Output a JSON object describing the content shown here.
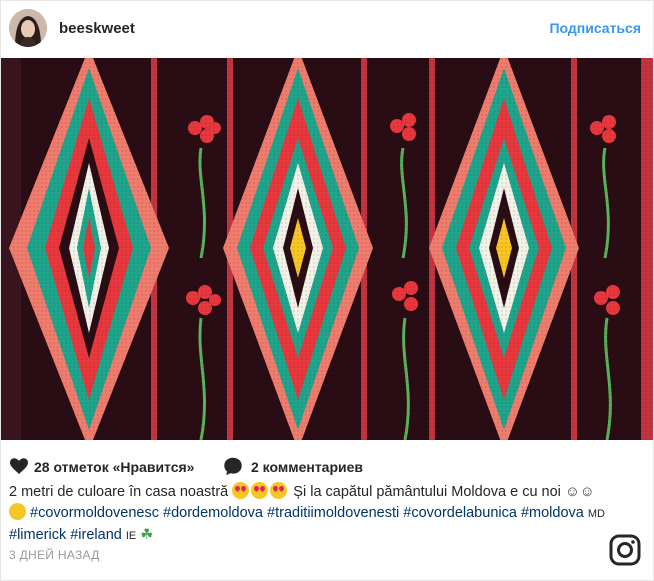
{
  "header": {
    "username": "beeskweet",
    "follow_label": "Подписаться"
  },
  "photo": {
    "alt": "Moldovan woven carpet",
    "colors": {
      "red": "#e8383d",
      "teal": "#1fa58c",
      "pink": "#f07c6e",
      "dark": "#2a0d14",
      "green": "#58b35b"
    }
  },
  "actions": {
    "likes_label": "28 отметок «Нравится»",
    "comments_label": "2 комментариев"
  },
  "caption": {
    "text_1": "2 metri de culoare în casa noastră",
    "text_2": "Și la capătul pământului Moldova e cu noi",
    "text_3": "☺☺",
    "hashtags_line1": [
      "#covormoldovenesc",
      "#dordemoldova",
      "#traditiimoldovenesti"
    ],
    "hashtags_line2_a": [
      "#covordelabunica",
      "#moldova"
    ],
    "flag_md": "MD",
    "hashtags_line2_b": [
      "#limerick",
      "#ireland"
    ],
    "flag_ie": "IE",
    "clover": "☘"
  },
  "footer": {
    "timestamp": "3 ДНЕЙ НАЗАД"
  },
  "icons": {
    "heart": "heart-icon",
    "comment": "comment-icon",
    "instagram": "instagram-icon"
  }
}
